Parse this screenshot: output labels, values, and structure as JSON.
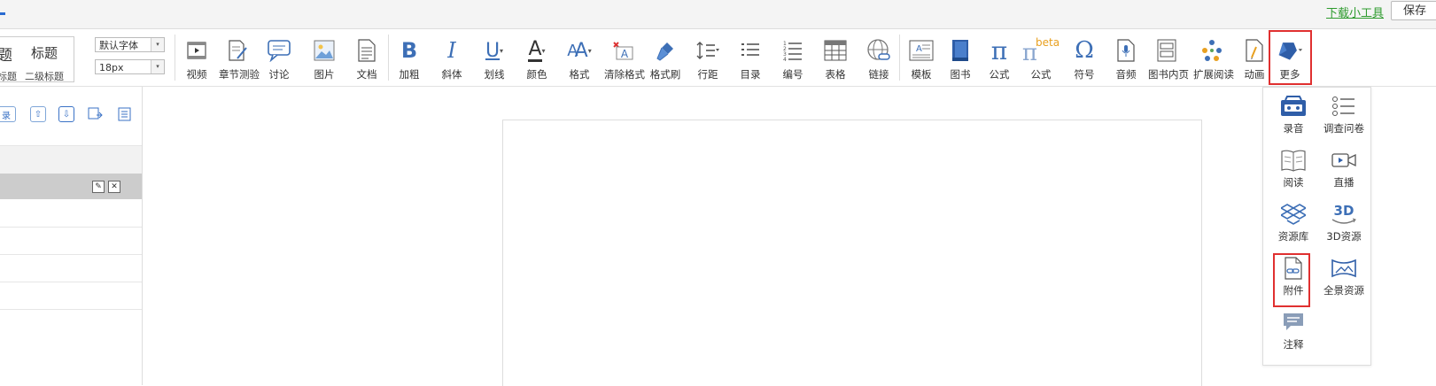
{
  "topbar": {
    "download_link": "下载小工具",
    "save_label": "保存"
  },
  "heading_box": {
    "big1": "题",
    "big2": "标题",
    "small1": "标题",
    "small2": "二级标题"
  },
  "font_select": {
    "value": "默认字体"
  },
  "size_select": {
    "value": "18px"
  },
  "toolbar": {
    "video": "视频",
    "chapter_test": "章节测验",
    "discuss": "讨论",
    "image": "图片",
    "doc": "文档",
    "bold": "加粗",
    "italic": "斜体",
    "underline": "划线",
    "color": "颜色",
    "format": "格式",
    "clear_format": "清除格式",
    "format_brush": "格式刷",
    "line_height": "行距",
    "toc": "目录",
    "numbering": "编号",
    "table": "表格",
    "link": "链接",
    "template": "模板",
    "book": "图书",
    "formula": "公式",
    "formula_beta": "公式",
    "beta": "beta",
    "symbol": "符号",
    "audio": "音频",
    "book_page": "图书内页",
    "extended_reading": "扩展阅读",
    "animation": "动画",
    "more": "更多"
  },
  "glyphs": {
    "bold": "B",
    "italic": "I",
    "underline": "U",
    "color": "A",
    "format": "A",
    "pi": "π",
    "omega": "Ω",
    "dropdown_arrow": "▾"
  },
  "left_panel": {
    "record_partial": "录"
  },
  "dropdown": {
    "record": "录音",
    "survey": "调查问卷",
    "reading": "阅读",
    "live": "直播",
    "resource_lib": "资源库",
    "resource_3d": "3D资源",
    "attachment": "附件",
    "panorama": "全景资源",
    "annotation": "注释",
    "threed_glyph": "3D"
  },
  "colors": {
    "accent": "#2a6bd1",
    "icon_blue": "#3d6fb6",
    "link_green": "#2e9b2e",
    "highlight_red": "#e03030"
  }
}
